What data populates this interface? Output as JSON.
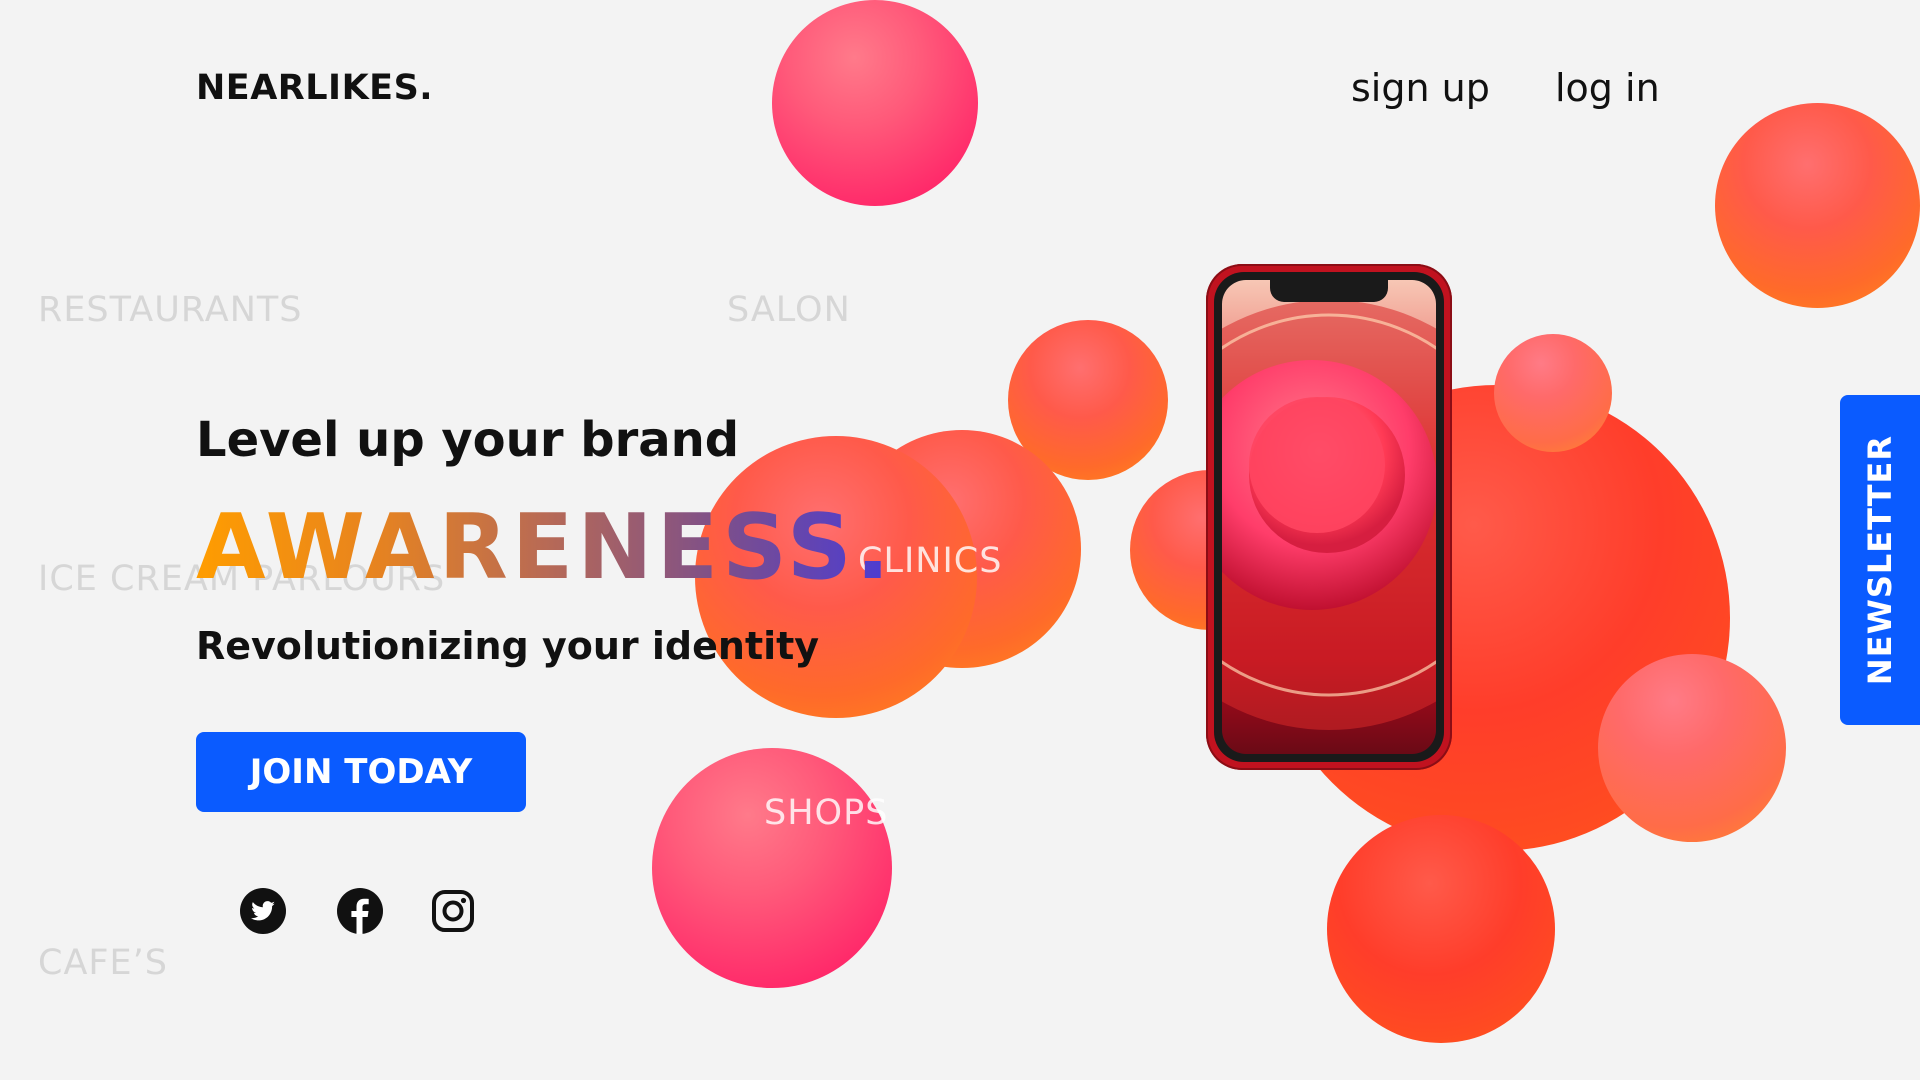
{
  "brand": {
    "logo": "NEARLIKES."
  },
  "nav": {
    "signup": "sign up",
    "login": "log in"
  },
  "hero": {
    "tagline": "Level up your brand",
    "headline": "AWARENESS.",
    "subheadline": "Revolutionizing your identity",
    "cta": "JOIN TODAY"
  },
  "categories": {
    "restaurants": "RESTAURANTS",
    "salon": "SALON",
    "ice_cream": "ICE CREAM PARLOURS",
    "clinics": "CLINICS",
    "shops": "SHOPS",
    "cafes": "CAFE’S"
  },
  "social": {
    "icons": [
      "twitter-icon",
      "facebook-icon",
      "instagram-icon"
    ]
  },
  "sidebar": {
    "newsletter": "NEWSLETTER"
  },
  "colors": {
    "background": "#f3f3f3",
    "primary_blue": "#0a5bff",
    "text": "#111111",
    "faded_text": "#d6d6d6",
    "gradient_start": "#ff9d00",
    "gradient_end": "#4a3bd6"
  }
}
